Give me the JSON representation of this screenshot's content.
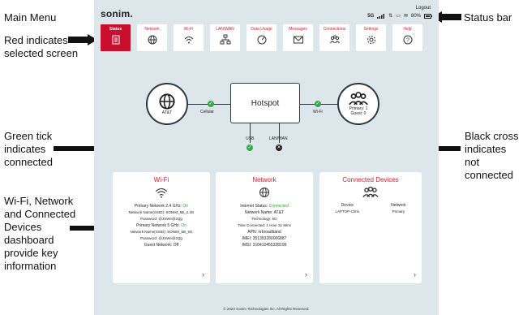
{
  "annotations": {
    "main_menu": "Main Menu",
    "red_indicates": [
      "Red indicates",
      "selected screen"
    ],
    "status_bar": "Status bar",
    "green_tick": [
      "Green tick",
      "indicates",
      "connected"
    ],
    "black_cross": [
      "Black cross",
      "indicates not",
      "connected"
    ],
    "dashboard": [
      "Wi-Fi, Network",
      "and Connected",
      "Devices",
      "dashboard",
      "provide key",
      "information"
    ]
  },
  "header": {
    "logo": "sonim.",
    "logout": "Logout",
    "status": {
      "network_type": "5G",
      "battery": "80%"
    }
  },
  "tabs": [
    {
      "label": "Status",
      "icon": "clipboard-icon",
      "active": true
    },
    {
      "label": "Network",
      "icon": "globe-icon",
      "active": false
    },
    {
      "label": "Wi-Fi",
      "icon": "wifi-icon",
      "active": false
    },
    {
      "label": "LAN/WAN",
      "icon": "lan-icon",
      "active": false
    },
    {
      "label": "Data Usage",
      "icon": "gauge-icon",
      "active": false
    },
    {
      "label": "Messages",
      "icon": "envelope-icon",
      "active": false
    },
    {
      "label": "Connections",
      "icon": "users-icon",
      "active": false
    },
    {
      "label": "Settings",
      "icon": "gear-icon",
      "active": false
    },
    {
      "label": "Help",
      "icon": "help-icon",
      "active": false
    }
  ],
  "diagram": {
    "carrier": "AT&T",
    "cellular": "Cellular",
    "hub": "Hotspot",
    "wifi": "Wi-Fi",
    "primary": "Primary: 1",
    "guest": "Guest: 0",
    "usb": "USB",
    "lanwan": "LAN/WAN",
    "usb_connected": true,
    "lanwan_connected": false
  },
  "cards": {
    "wifi": {
      "title": "Wi-Fi",
      "rows": [
        {
          "label": "Primary Network 2.4 GHz: ",
          "value": "On"
        },
        {
          "label": "Network Name(SSID): SONIM_5B_2.4G",
          "value": ""
        },
        {
          "label": "Password: @JSWe@2Qg",
          "value": ""
        },
        {
          "label": "Primary Network 5 GHz: ",
          "value": "On"
        },
        {
          "label": "Network Name(SSID): SONIM_5B_5G",
          "value": ""
        },
        {
          "label": "Password: @JSWe@2Qg",
          "value": ""
        },
        {
          "label": "Guest Network: Off",
          "value": ""
        }
      ]
    },
    "network": {
      "title": "Network",
      "rows": [
        {
          "label": "Internet Status: ",
          "value": "Connected"
        },
        {
          "label": "Network Name: AT&T",
          "value": ""
        },
        {
          "label": "Technology: 5G",
          "value": ""
        },
        {
          "label": "Time Connected: 1 Hour 31 Mins",
          "value": ""
        },
        {
          "label": "APN: nrbroadband",
          "value": ""
        },
        {
          "label": "IMEI: 351393280006887",
          "value": ""
        },
        {
          "label": "IMSI: 310410455328199",
          "value": ""
        }
      ]
    },
    "devices": {
      "title": "Connected Devices",
      "col1": "Device",
      "col2": "Network",
      "device": "LAPTOP-Chris",
      "network": "Primary"
    }
  },
  "footer": "© 2023 Sonim Technologies Inc. All Rights Reserved."
}
